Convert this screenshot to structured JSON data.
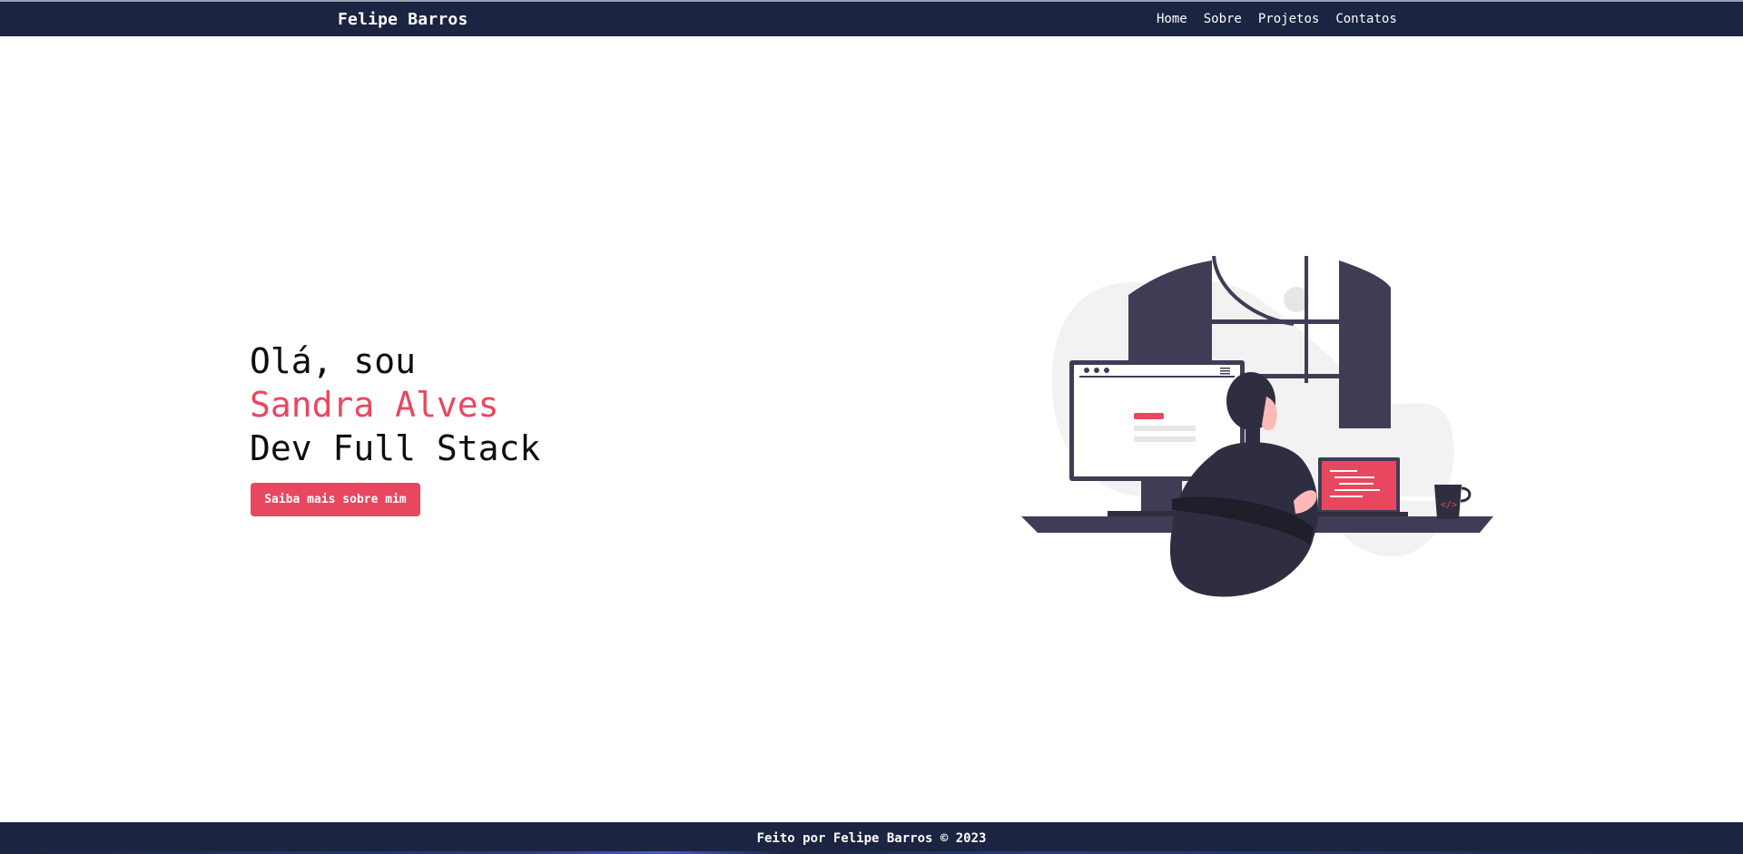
{
  "navbar": {
    "brand": "Felipe Barros",
    "links": [
      "Home",
      "Sobre",
      "Projetos",
      "Contatos"
    ]
  },
  "hero": {
    "greeting": "Olá, sou",
    "name": "Sandra Alves",
    "role": "Dev Full Stack",
    "cta_label": "Saiba mais sobre mim"
  },
  "footer": {
    "text": "Feito por Felipe Barros © 2023"
  },
  "colors": {
    "navbar_bg": "#1b2440",
    "accent": "#e8485f",
    "text_dark": "#0d0d0d",
    "illustration_dark": "#3f3d56"
  }
}
